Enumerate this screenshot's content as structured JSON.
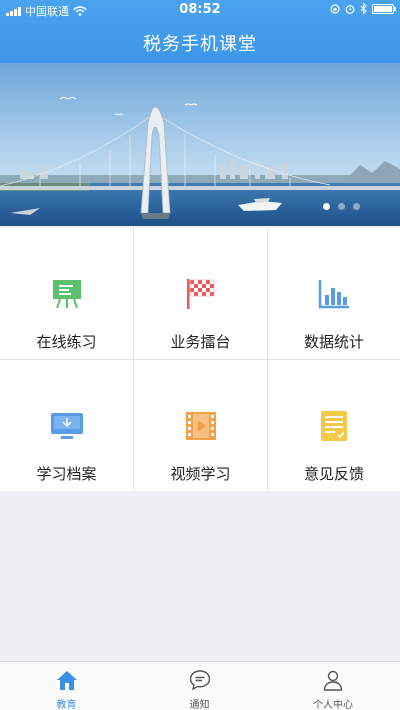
{
  "status": {
    "carrier": "中国联通",
    "time": "08:52"
  },
  "header": {
    "title": "税务手机课堂"
  },
  "banner": {
    "dots": 3,
    "active_dot": 1
  },
  "grid": [
    {
      "label": "在线练习",
      "icon": "presentation-board-icon"
    },
    {
      "label": "业务擂台",
      "icon": "checkered-flag-icon"
    },
    {
      "label": "数据统计",
      "icon": "bar-chart-icon"
    },
    {
      "label": "学习档案",
      "icon": "monitor-icon"
    },
    {
      "label": "视频学习",
      "icon": "film-icon"
    },
    {
      "label": "意见反馈",
      "icon": "document-icon"
    }
  ],
  "tabbar": [
    {
      "label": "教育",
      "icon": "home-icon",
      "active": true
    },
    {
      "label": "通知",
      "icon": "chat-bubble-icon",
      "active": false
    },
    {
      "label": "个人中心",
      "icon": "user-icon",
      "active": false
    }
  ],
  "colors": {
    "accent": "#3d96e8",
    "green": "#5cc16c",
    "red": "#e85b5b",
    "blue": "#5a9be6",
    "orange": "#f0a24a",
    "yellow": "#f5c84a"
  }
}
